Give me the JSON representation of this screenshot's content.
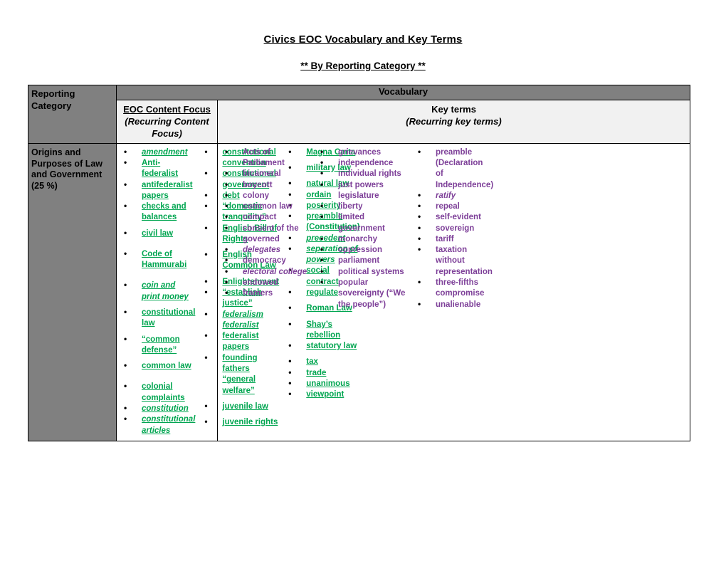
{
  "document": {
    "title": "Civics EOC Vocabulary and Key Terms",
    "subtitle": "** By Reporting Category **"
  },
  "colors": {
    "eoc_term_green": "#00a550",
    "key_term_purple": "#7d3f98",
    "header_gray": "#808080",
    "header_light": "#f1f1f1"
  },
  "table": {
    "headers": {
      "reporting_category": "Reporting Category",
      "vocabulary_band": "Vocabulary",
      "eoc_content_focus": "EOC Content Focus",
      "eoc_content_focus_sub": "(Recurring Content Focus)",
      "key_terms": "Key terms",
      "key_terms_sub": "(Recurring key terms)"
    },
    "rows": [
      {
        "category": "Origins and Purposes of Law and Government (25 %)",
        "eoc_content_focus": {
          "col1": [
            {
              "text": "amendment",
              "italic": true,
              "gap": "none"
            },
            {
              "text": "Anti-federalist",
              "italic": false,
              "gap": "none"
            },
            {
              "text": "antifederalist papers",
              "italic": false,
              "gap": "none"
            },
            {
              "text": "checks and balances",
              "italic": false,
              "gap": "small"
            },
            {
              "text": "civil law",
              "italic": false,
              "gap": "large"
            },
            {
              "text": "Code of Hammurabi",
              "italic": false,
              "gap": "large"
            },
            {
              "text": "coin and print money",
              "italic": true,
              "gap": "small"
            },
            {
              "text": "constitutional law",
              "italic": false,
              "gap": "small"
            },
            {
              "text": "“common defense”",
              "italic": false,
              "gap": "small"
            },
            {
              "text": "common law",
              "italic": false,
              "gap": "large"
            },
            {
              "text": "colonial complaints",
              "italic": false,
              "gap": "none"
            },
            {
              "text": "constitution",
              "italic": true,
              "gap": "none"
            },
            {
              "text": "constitutional articles",
              "italic": true,
              "gap": "none"
            }
          ],
          "col2": [
            {
              "text": "constitutional convention",
              "italic": false,
              "gap": "none"
            },
            {
              "text": "constitutional government",
              "italic": false,
              "gap": "none"
            },
            {
              "text": "debt",
              "italic": false,
              "gap": "none"
            },
            {
              "text": "“domestic tranquility”",
              "italic": false,
              "gap": "none"
            },
            {
              "text": "English Bill of Rights",
              "italic": false,
              "gap": "small"
            },
            {
              "text": "English Common Law",
              "italic": false,
              "gap": "small"
            },
            {
              "text": "Enlightenment",
              "italic": false,
              "gap": "none"
            },
            {
              "text": "“establish justice”",
              "italic": false,
              "gap": "none"
            },
            {
              "text": "federalism federalist",
              "italic": true,
              "gap": "none"
            },
            {
              "text": "federalist papers",
              "italic": false,
              "gap": "none"
            },
            {
              "text": "founding fathers “general welfare”",
              "italic": false,
              "gap": "small"
            },
            {
              "text": "juvenile law",
              "italic": false,
              "gap": "small"
            },
            {
              "text": "juvenile rights",
              "italic": false,
              "gap": "none"
            }
          ],
          "col3": [
            {
              "text": "Magna Carta",
              "italic": false,
              "gap": "small"
            },
            {
              "text": "military law",
              "italic": false,
              "gap": "small"
            },
            {
              "text": "natural law",
              "italic": false,
              "gap": "none"
            },
            {
              "text": "ordain",
              "italic": false,
              "gap": "none"
            },
            {
              "text": "posterity",
              "italic": false,
              "gap": "none"
            },
            {
              "text": "preamble (Constitution)",
              "italic": false,
              "gap": "none"
            },
            {
              "text": "precedent",
              "italic": true,
              "gap": "none"
            },
            {
              "text": "separation of powers",
              "italic": true,
              "gap": "none"
            },
            {
              "text": "social contract",
              "italic": false,
              "gap": "none"
            },
            {
              "text": "regulate",
              "italic": false,
              "gap": "small"
            },
            {
              "text": "Roman Law",
              "italic": false,
              "gap": "small"
            },
            {
              "text": "Shay’s rebellion",
              "italic": false,
              "gap": "none"
            },
            {
              "text": "statutory law",
              "italic": false,
              "gap": "small"
            },
            {
              "text": "tax",
              "italic": false,
              "gap": "none"
            },
            {
              "text": "trade",
              "italic": false,
              "gap": "none"
            },
            {
              "text": "unanimous",
              "italic": false,
              "gap": "none"
            },
            {
              "text": "viewpoint",
              "italic": false,
              "gap": "none"
            }
          ]
        },
        "key_terms": {
          "col1": [
            {
              "text": "Acts of Parliament",
              "italic": false
            },
            {
              "text": "bicameral",
              "italic": false
            },
            {
              "text": "boycott",
              "italic": false
            },
            {
              "text": "colony",
              "italic": false
            },
            {
              "text": "common law",
              "italic": false
            },
            {
              "text": "compact",
              "italic": false
            },
            {
              "text": "consent of the governed",
              "italic": false
            },
            {
              "text": "delegates",
              "italic": true
            },
            {
              "text": "democracy",
              "italic": false
            },
            {
              "text": "electoral college",
              "italic": true
            },
            {
              "text": "endowed",
              "italic": false
            },
            {
              "text": "framers",
              "italic": false
            }
          ],
          "col2": [
            {
              "text": "grievances",
              "italic": false
            },
            {
              "text": "independence",
              "italic": false
            },
            {
              "text": "individual rights",
              "italic": false
            },
            {
              "text": "just powers legislature",
              "italic": false
            },
            {
              "text": "liberty",
              "italic": false
            },
            {
              "text": "limited government",
              "italic": false
            },
            {
              "text": "monarchy",
              "italic": false
            },
            {
              "text": "oppression",
              "italic": false
            },
            {
              "text": "parliament",
              "italic": false
            },
            {
              "text": "political systems",
              "italic": false
            },
            {
              "text": "popular sovereignty (“We the people”)",
              "italic": false
            }
          ],
          "col3": [
            {
              "text": "preamble (Declaration of Independence)",
              "italic": false
            },
            {
              "text": "ratify",
              "italic": true
            },
            {
              "text": "repeal",
              "italic": false
            },
            {
              "text": "self-evident",
              "italic": false
            },
            {
              "text": "sovereign",
              "italic": false
            },
            {
              "text": "tariff",
              "italic": false
            },
            {
              "text": "taxation without representation",
              "italic": false
            },
            {
              "text": "three-fifths compromise",
              "italic": false
            },
            {
              "text": "unalienable",
              "italic": false
            }
          ]
        }
      }
    ]
  }
}
